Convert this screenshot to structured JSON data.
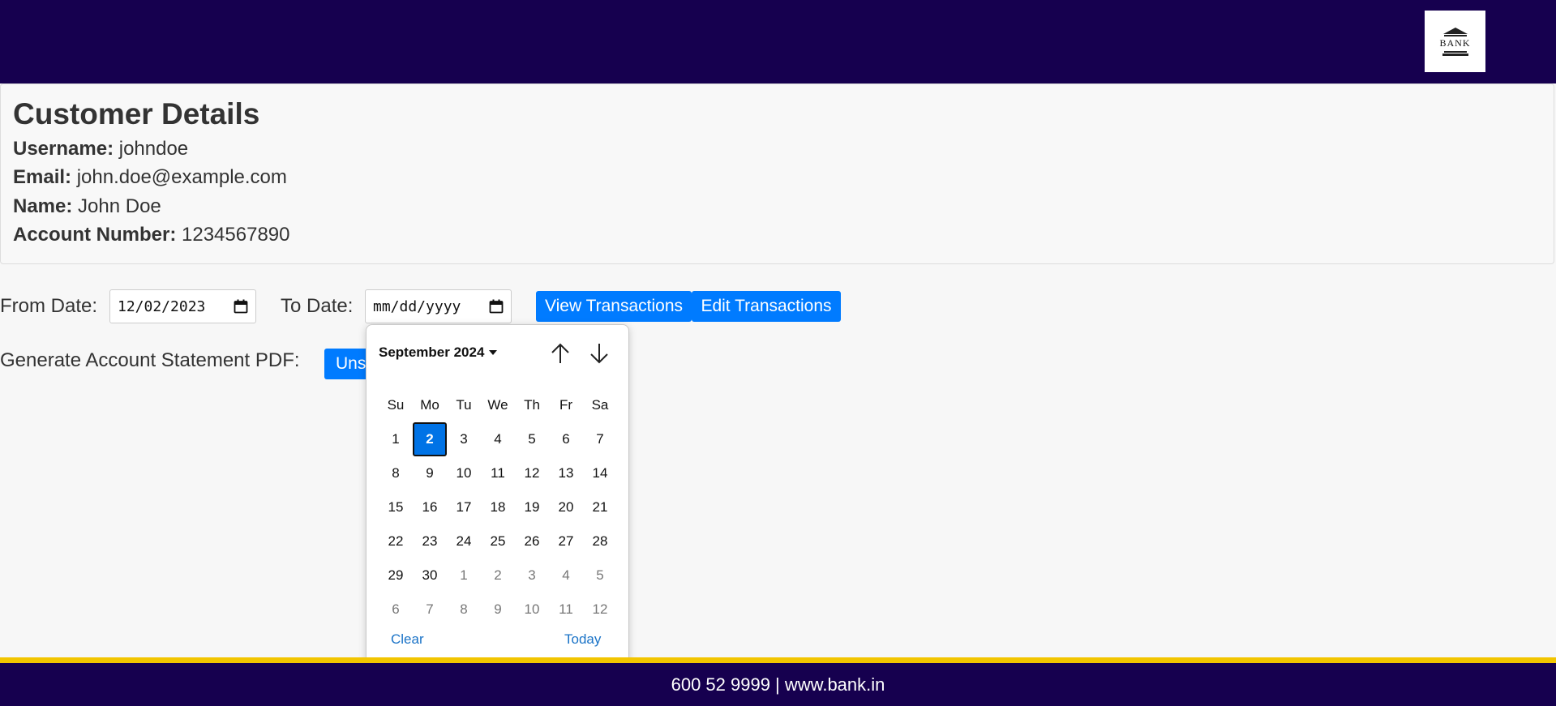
{
  "header": {
    "logo_text": "BANK"
  },
  "customer": {
    "title": "Customer Details",
    "username_label": "Username:",
    "username": "johndoe",
    "email_label": "Email:",
    "email": "john.doe@example.com",
    "name_label": "Name:",
    "name": "John Doe",
    "account_label": "Account Number:",
    "account": "1234567890"
  },
  "filters": {
    "from_label": "From Date:",
    "from_value": "12/02/2023",
    "to_label": "To Date:",
    "to_placeholder": "mm/dd/yyyy",
    "view_button": "View Transactions",
    "edit_button": "Edit Transactions"
  },
  "statement": {
    "label": "Generate Account Statement PDF:",
    "button_partial": "Uns"
  },
  "datepicker": {
    "month_label": "September 2024",
    "weekdays": [
      "Su",
      "Mo",
      "Tu",
      "We",
      "Th",
      "Fr",
      "Sa"
    ],
    "selected_day": "2",
    "weeks": [
      [
        "1",
        "2",
        "3",
        "4",
        "5",
        "6",
        "7"
      ],
      [
        "8",
        "9",
        "10",
        "11",
        "12",
        "13",
        "14"
      ],
      [
        "15",
        "16",
        "17",
        "18",
        "19",
        "20",
        "21"
      ],
      [
        "22",
        "23",
        "24",
        "25",
        "26",
        "27",
        "28"
      ],
      [
        "29",
        "30",
        "1",
        "2",
        "3",
        "4",
        "5"
      ],
      [
        "6",
        "7",
        "8",
        "9",
        "10",
        "11",
        "12"
      ]
    ],
    "clear_label": "Clear",
    "today_label": "Today"
  },
  "footer": {
    "text": "600 52 9999 | www.bank.in"
  },
  "colors": {
    "header_bg": "#16004f",
    "accent": "#007bff",
    "footer_stripe": "#f2c500"
  }
}
